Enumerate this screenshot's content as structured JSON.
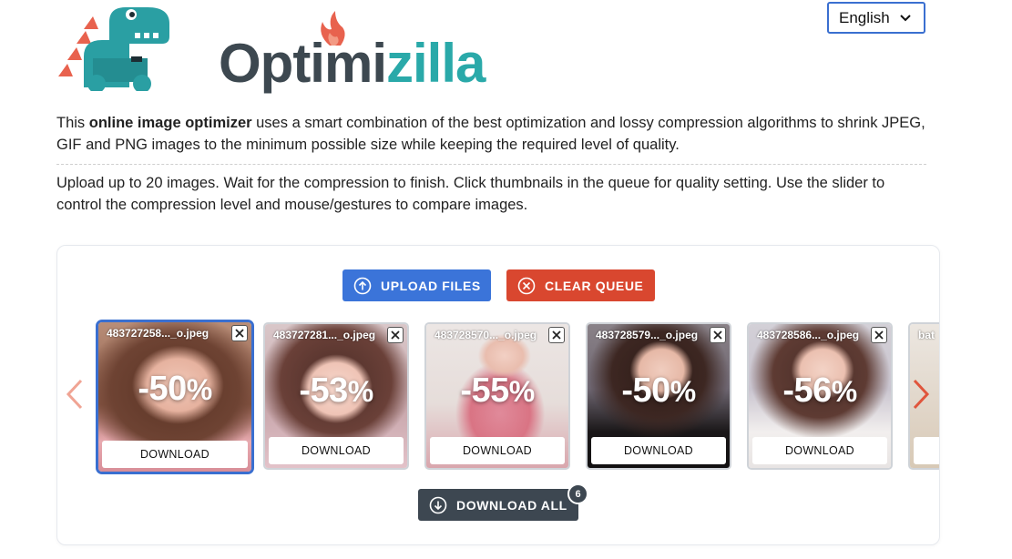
{
  "logo": {
    "part1": "Optimi",
    "part2": "zilla"
  },
  "language": {
    "selected": "English"
  },
  "description": {
    "p1_before": "This ",
    "p1_bold": "online image optimizer",
    "p1_after": " uses a smart combination of the best optimization and lossy compression algorithms to shrink JPEG, GIF and PNG images to the minimum possible size while keeping the required level of quality.",
    "p2": "Upload up to 20 images. Wait for the compression to finish. Click thumbnails in the queue for quality setting. Use the slider to control the compression level and mouse/gestures to compare images."
  },
  "toolbar": {
    "upload_label": "UPLOAD FILES",
    "clear_label": "CLEAR QUEUE"
  },
  "queue": {
    "items": [
      {
        "name": "483727258..._o.jpeg",
        "percent": "-50",
        "download_label": "DOWNLOAD"
      },
      {
        "name": "483727281..._o.jpeg",
        "percent": "-53",
        "download_label": "DOWNLOAD"
      },
      {
        "name": "483728570..._o.jpeg",
        "percent": "-55",
        "download_label": "DOWNLOAD"
      },
      {
        "name": "483728579..._o.jpeg",
        "percent": "-50",
        "download_label": "DOWNLOAD"
      },
      {
        "name": "483728586..._o.jpeg",
        "percent": "-56",
        "download_label": "DOWNLOAD"
      },
      {
        "name": "bat",
        "percent": "",
        "download_label": ""
      }
    ],
    "percent_suffix": "%"
  },
  "download_all": {
    "label": "DOWNLOAD ALL",
    "count": "6"
  },
  "colors": {
    "accent_blue": "#3b74d9",
    "accent_red": "#d9472f",
    "dark": "#3d4751",
    "teal": "#2aa9a9"
  }
}
